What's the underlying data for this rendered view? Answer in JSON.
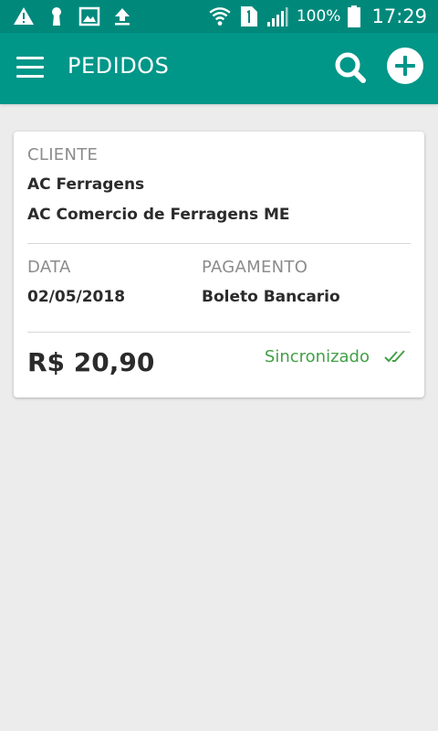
{
  "colors": {
    "statusbar_bg": "#00897b",
    "toolbar_bg": "#009688",
    "page_bg": "#ececec",
    "sync_green": "#43a047"
  },
  "status_bar": {
    "left_icons": [
      "warning-icon",
      "keyhole-icon",
      "image-icon",
      "upload-icon"
    ],
    "right_icons": [
      "wifi-icon",
      "sim-1-icon",
      "signal-icon",
      "battery-icon"
    ],
    "battery": "100%",
    "time": "17:29"
  },
  "toolbar": {
    "menu_icon": "menu-icon",
    "title": "PEDIDOS",
    "search_icon": "search-icon",
    "add_icon": "add-circle-icon"
  },
  "order": {
    "cliente_label": "CLIENTE",
    "cliente_fantasia": "AC Ferragens",
    "cliente_razao": "AC Comercio de Ferragens ME",
    "data_label": "DATA",
    "data": "02/05/2018",
    "pagamento_label": "PAGAMENTO",
    "pagamento": "Boleto Bancario",
    "total": "R$ 20,90",
    "status": "Sincronizado",
    "status_icon": "double-check-icon"
  }
}
